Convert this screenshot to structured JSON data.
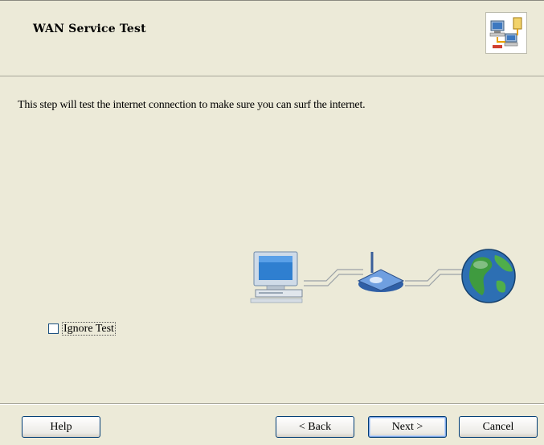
{
  "header": {
    "title": "WAN Service Test",
    "icon": "network-wizard-icon"
  },
  "main": {
    "description": "This step will test the internet connection to make sure you can surf the internet.",
    "illustration": [
      "computer-icon",
      "cable",
      "router-icon",
      "cable",
      "globe-icon"
    ],
    "ignore_test": {
      "label": "Ignore Test",
      "checked": false
    }
  },
  "footer": {
    "help_label": "Help",
    "back_label": "< Back",
    "next_label": "Next >",
    "cancel_label": "Cancel"
  },
  "colors": {
    "background": "#ecead8",
    "button_border": "#003c74",
    "default_button_focus": "#7ca4e4"
  }
}
